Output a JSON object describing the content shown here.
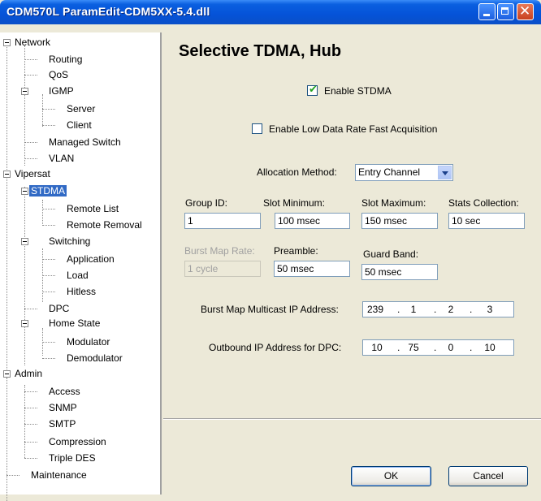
{
  "window": {
    "title": "CDM570L ParamEdit-CDM5XX-5.4.dll"
  },
  "tree": {
    "items": [
      {
        "label": "Network"
      },
      {
        "label": "Routing"
      },
      {
        "label": "QoS"
      },
      {
        "label": "IGMP"
      },
      {
        "label": "Server"
      },
      {
        "label": "Client"
      },
      {
        "label": "Managed Switch"
      },
      {
        "label": "VLAN"
      },
      {
        "label": "Vipersat"
      },
      {
        "label": "STDMA"
      },
      {
        "label": "Remote List"
      },
      {
        "label": "Remote Removal"
      },
      {
        "label": "Switching"
      },
      {
        "label": "Application"
      },
      {
        "label": "Load"
      },
      {
        "label": "Hitless"
      },
      {
        "label": "DPC"
      },
      {
        "label": "Home State"
      },
      {
        "label": "Modulator"
      },
      {
        "label": "Demodulator"
      },
      {
        "label": "Admin"
      },
      {
        "label": "Access"
      },
      {
        "label": "SNMP"
      },
      {
        "label": "SMTP"
      },
      {
        "label": "Compression"
      },
      {
        "label": "Triple DES"
      },
      {
        "label": "Maintenance"
      }
    ]
  },
  "page": {
    "title": "Selective TDMA, Hub",
    "enable_stdma": {
      "label": "Enable STDMA",
      "checked": true
    },
    "enable_low_rate": {
      "label": "Enable Low Data Rate Fast Acquisition",
      "checked": false
    },
    "allocation": {
      "label": "Allocation Method:",
      "value": "Entry Channel"
    },
    "group_id": {
      "label": "Group ID:",
      "value": "1"
    },
    "slot_min": {
      "label": "Slot Minimum:",
      "value": "100 msec"
    },
    "slot_max": {
      "label": "Slot Maximum:",
      "value": "150 msec"
    },
    "stats": {
      "label": "Stats Collection:",
      "value": "10 sec"
    },
    "burst_rate": {
      "label": "Burst Map Rate:",
      "value": "1 cycle"
    },
    "preamble": {
      "label": "Preamble:",
      "value": "50 msec"
    },
    "guard": {
      "label": "Guard Band:",
      "value": "50 msec"
    },
    "burst_ip": {
      "label": "Burst Map Multicast IP Address:",
      "octets": [
        "239",
        "1",
        "2",
        "3"
      ]
    },
    "outbound_ip": {
      "label": "Outbound IP Address for DPC:",
      "octets": [
        "10",
        "75",
        "0",
        "10"
      ]
    },
    "ip_dot": "."
  },
  "buttons": {
    "ok": "OK",
    "cancel": "Cancel"
  },
  "colors": {
    "titlebar": "#0553d8",
    "selection": "#316ac5",
    "dialog_bg": "#ece9d8"
  }
}
